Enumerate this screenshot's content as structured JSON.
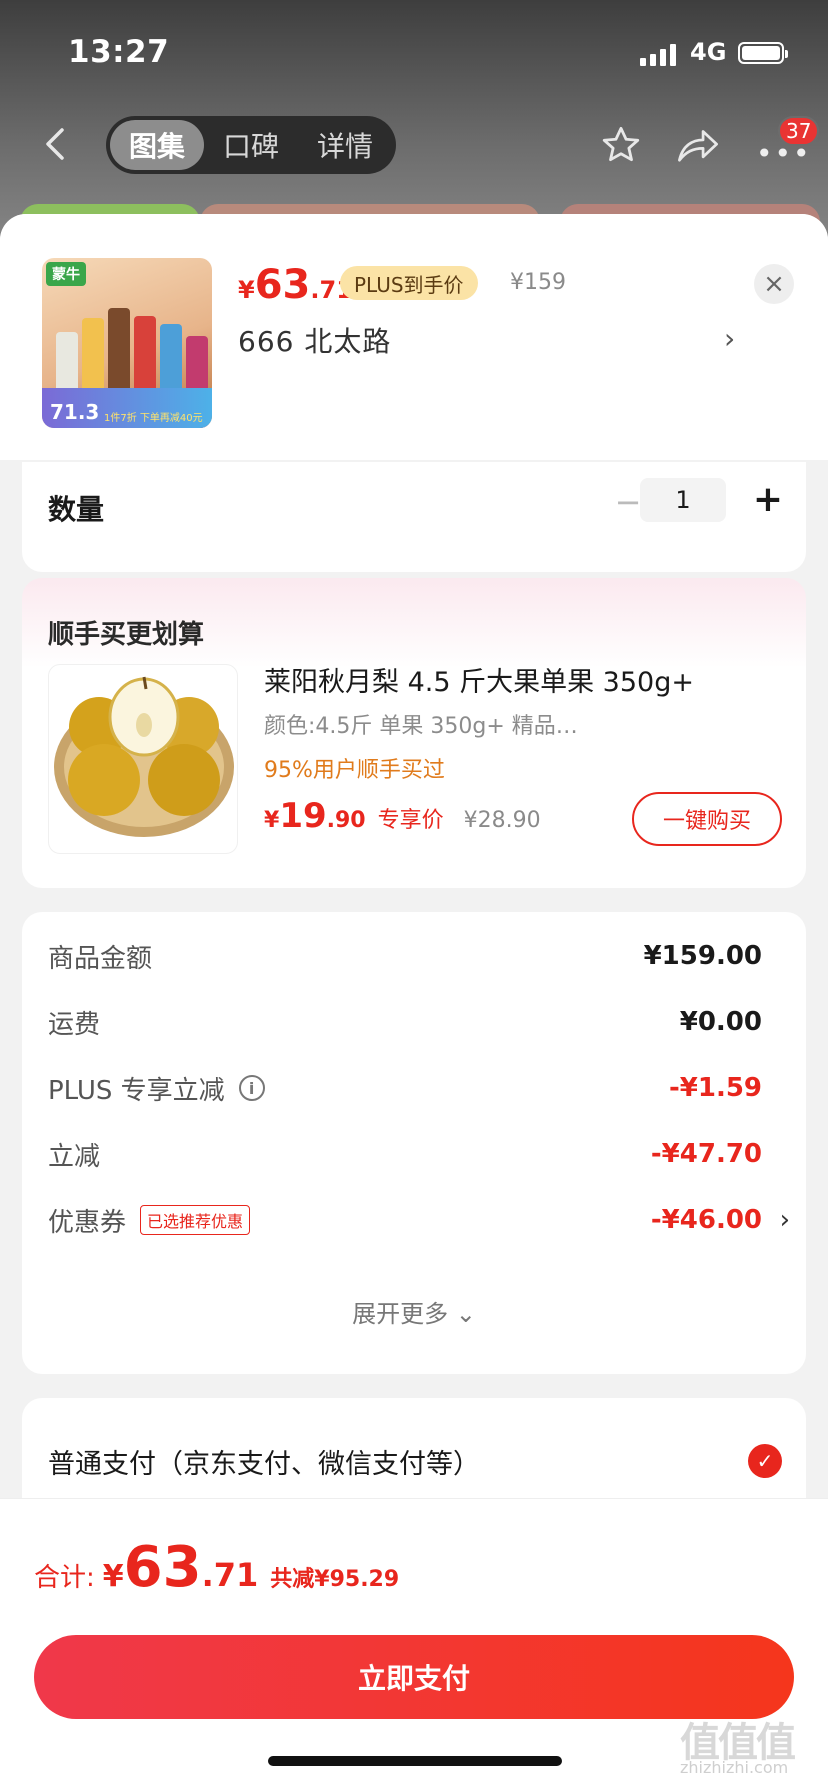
{
  "status_bar": {
    "time": "13:27",
    "network": "4G"
  },
  "nav": {
    "tabs": [
      {
        "label": "图集",
        "active": true
      },
      {
        "label": "口碑",
        "active": false
      },
      {
        "label": "详情",
        "active": false
      }
    ],
    "more_badge": "37",
    "icons": [
      "back-icon",
      "star-icon",
      "share-icon",
      "more-icon"
    ]
  },
  "product": {
    "thumb_brand": "蒙牛",
    "thumb_price": "71.3",
    "thumb_promo": "1件7折 下单再减40元",
    "price_yen": "¥",
    "price_int": "63",
    "price_dec": ".71",
    "plus_tag": "PLUS到手价",
    "original_price": "¥159",
    "address": "666  北太路",
    "address_chevron": "›",
    "close": "×"
  },
  "quantity": {
    "label": "数量",
    "minus": "−",
    "value": "1",
    "plus": "+"
  },
  "addon": {
    "title": "顺手买更划算",
    "name": "莱阳秋月梨 4.5 斤大果单果 350g+",
    "spec": "颜色:4.5斤 单果 350g+ 精品…",
    "social": "95%用户顺手买过",
    "price_yen": "¥",
    "price_int": "19",
    "price_dec": ".90",
    "price_tag": "专享价",
    "original_price": "¥28.90",
    "buy_label": "一键购买"
  },
  "fees": {
    "rows": [
      {
        "label": "商品金额",
        "amount": "¥159.00"
      },
      {
        "label": "运费",
        "amount": "¥0.00"
      },
      {
        "label": "PLUS 专享立减",
        "amount": "-¥1.59"
      },
      {
        "label": "立减",
        "amount": "-¥47.70"
      },
      {
        "label": "优惠券",
        "amount": "-¥46.00",
        "tag": "已选推荐优惠"
      }
    ],
    "expand_label": "展开更多 ⌄"
  },
  "payment": {
    "label": "普通支付（京东支付、微信支付等）",
    "selected": true,
    "check": "✓"
  },
  "footer": {
    "total_label": "合计:",
    "total_yen": "¥",
    "total_int": "63",
    "total_dec": ".71",
    "saved": "共减¥95.29",
    "pay_button": "立即支付"
  },
  "watermark": {
    "glyphs": "值值值",
    "site": "zhizhizhi.com"
  },
  "colors": {
    "accent": "#e8261d",
    "plus_tag_bg": "#fbe3a6",
    "social_orange": "#e07b1c"
  }
}
